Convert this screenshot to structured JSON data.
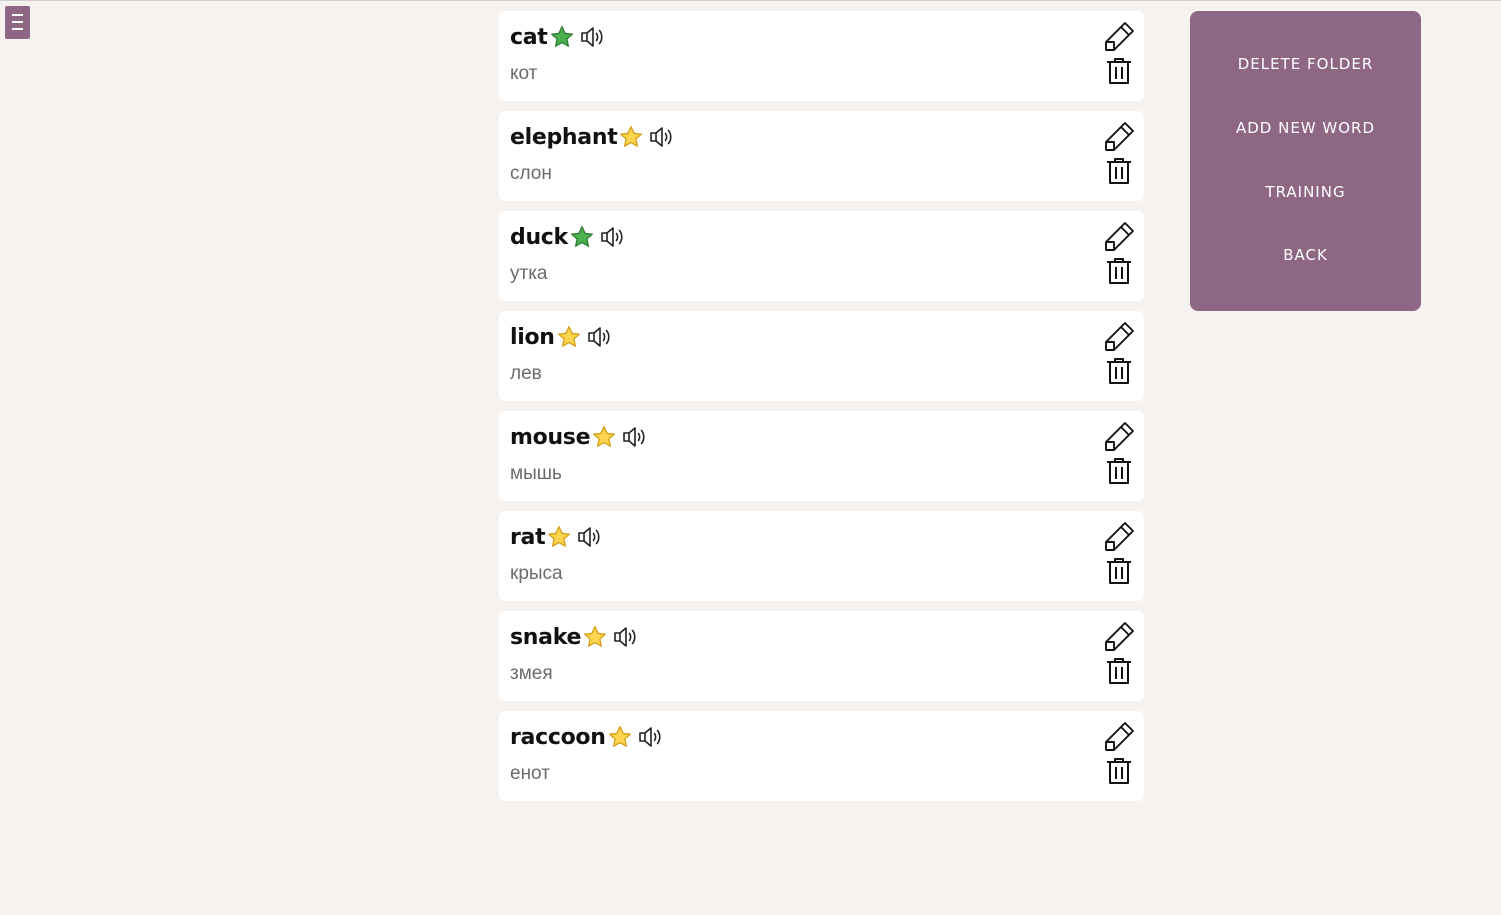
{
  "menu": {
    "icon": "hamburger-menu-icon"
  },
  "words": [
    {
      "word": "cat",
      "translation": "кот",
      "starred": true
    },
    {
      "word": "elephant",
      "translation": "слон",
      "starred": false
    },
    {
      "word": "duck",
      "translation": "утка",
      "starred": true
    },
    {
      "word": "lion",
      "translation": "лев",
      "starred": false
    },
    {
      "word": "mouse",
      "translation": "мышь",
      "starred": false
    },
    {
      "word": "rat",
      "translation": "крыса",
      "starred": false
    },
    {
      "word": "snake",
      "translation": "змея",
      "starred": false
    },
    {
      "word": "raccoon",
      "translation": "енот",
      "starred": false
    }
  ],
  "sidebar": {
    "delete_folder": "DELETE FOLDER",
    "add_new_word": "ADD NEW WORD",
    "training": "TRAINING",
    "back": "BACK"
  },
  "colors": {
    "accent": "#8e6785",
    "background": "#f6f2ef",
    "star_learned": "#4caf50",
    "star_unlearned": "#ffd54f"
  }
}
